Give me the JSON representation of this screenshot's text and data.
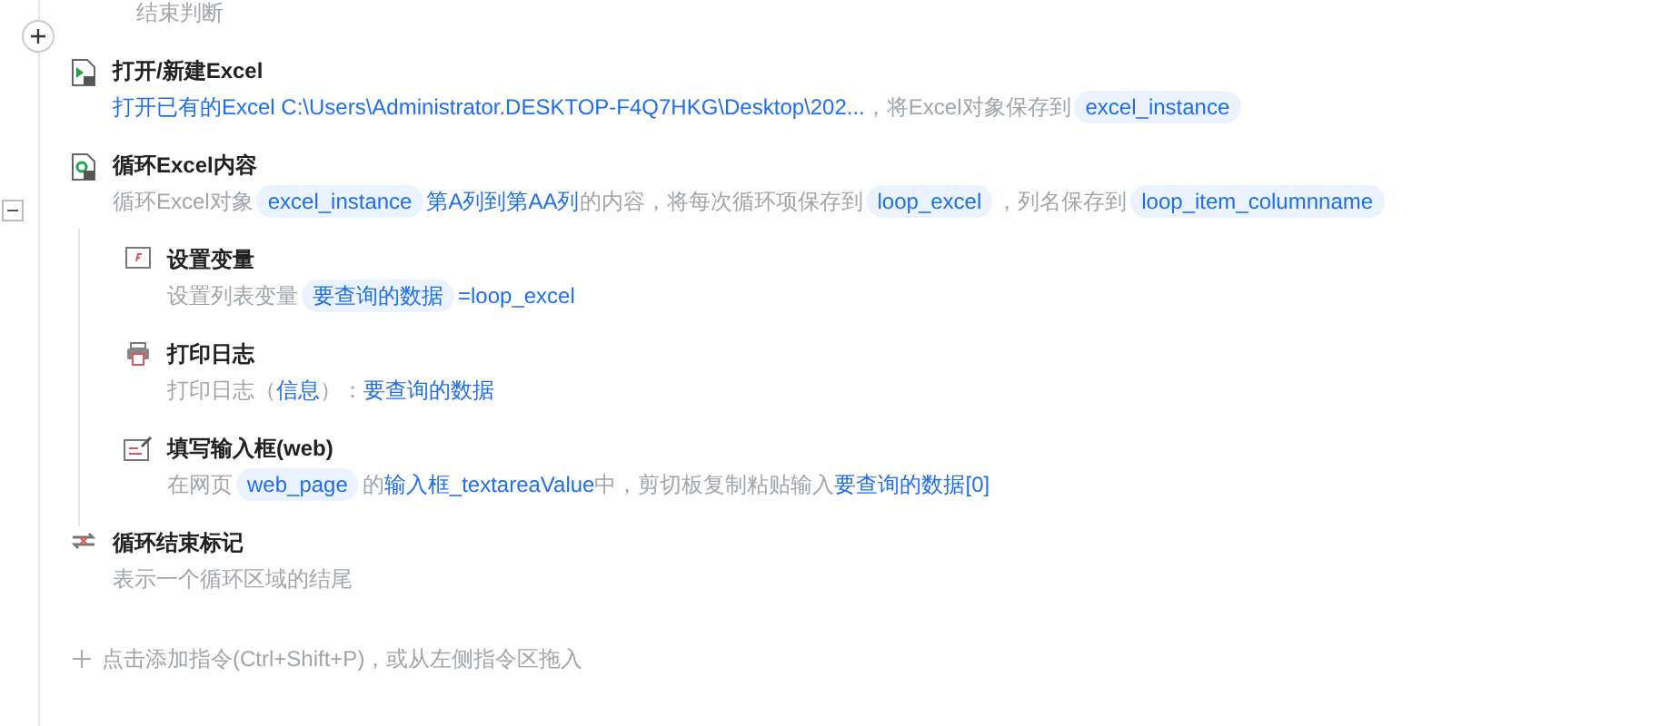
{
  "previous_step": {
    "description": "结束判断"
  },
  "steps": [
    {
      "kind": "open_excel",
      "title": "打开/新建Excel",
      "description": [
        {
          "kind": "link",
          "text": "打开已有的Excel C:\\Users\\Administrator.DESKTOP-F4Q7HKG\\Desktop\\202..."
        },
        {
          "kind": "text",
          "text": "，将Excel对象保存到"
        },
        {
          "kind": "chip",
          "text": "excel_instance"
        }
      ]
    },
    {
      "kind": "loop_excel",
      "title": "循环Excel内容",
      "expanded": true,
      "description": [
        {
          "kind": "text",
          "text": "循环Excel对象"
        },
        {
          "kind": "chip",
          "text": "excel_instance"
        },
        {
          "kind": "link",
          "text": "第A列到第AA列"
        },
        {
          "kind": "text",
          "text": "的内容，将每次循环项保存到"
        },
        {
          "kind": "chip",
          "text": "loop_excel"
        },
        {
          "kind": "text",
          "text": "，列名保存到"
        },
        {
          "kind": "chip",
          "text": "loop_item_columnname"
        }
      ],
      "children": [
        {
          "kind": "set_variable",
          "title": "设置变量",
          "description": [
            {
              "kind": "text",
              "text": "设置列表变量"
            },
            {
              "kind": "chip",
              "text": "要查询的数据"
            },
            {
              "kind": "link",
              "text": "=loop_excel"
            }
          ]
        },
        {
          "kind": "print_log",
          "title": "打印日志",
          "description": [
            {
              "kind": "text",
              "text": "打印日志（"
            },
            {
              "kind": "link",
              "text": "信息"
            },
            {
              "kind": "text",
              "text": "）："
            },
            {
              "kind": "link",
              "text": "要查询的数据"
            }
          ]
        },
        {
          "kind": "fill_input",
          "title": "填写输入框(web)",
          "description": [
            {
              "kind": "text",
              "text": "在网页"
            },
            {
              "kind": "chip",
              "text": "web_page"
            },
            {
              "kind": "text",
              "text": "的"
            },
            {
              "kind": "link",
              "text": "输入框_textareaValue"
            },
            {
              "kind": "text",
              "text": "中，剪切板复制粘贴输入"
            },
            {
              "kind": "link",
              "text": "要查询的数据[0]"
            }
          ]
        }
      ]
    },
    {
      "kind": "loop_end",
      "title": "循环结束标记",
      "description": [
        {
          "kind": "text",
          "text": "表示一个循环区域的结尾"
        }
      ]
    }
  ],
  "add_hint": "点击添加指令(Ctrl+Shift+P)，或从左侧指令区拖入"
}
